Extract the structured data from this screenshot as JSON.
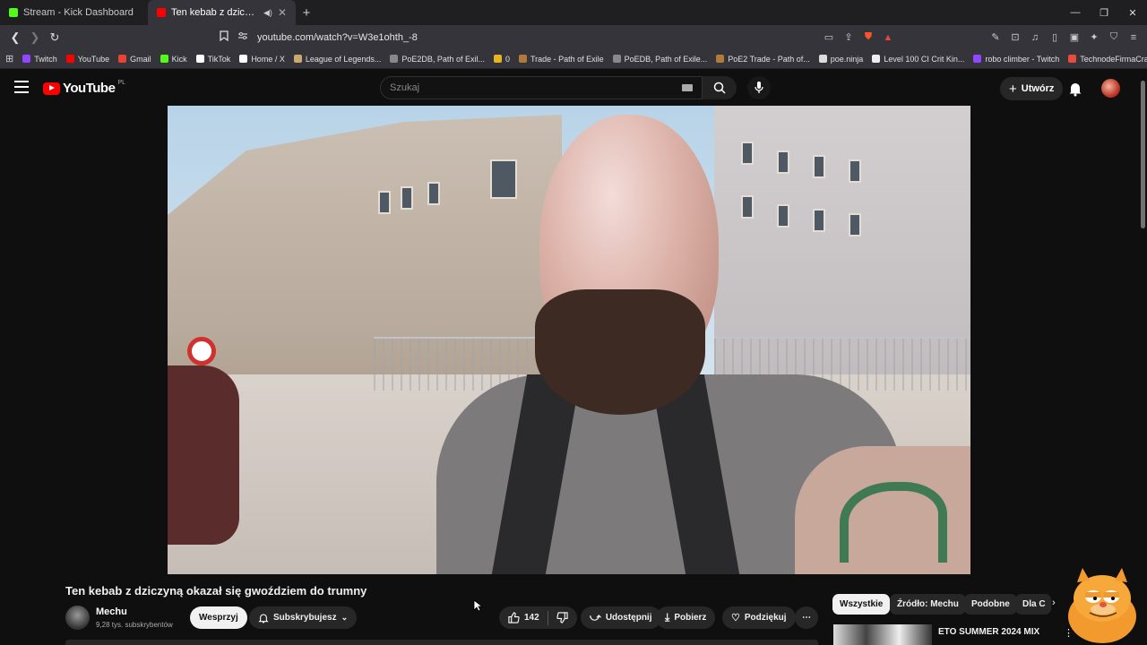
{
  "browser": {
    "tabs": [
      {
        "label": "Stream - Kick Dashboard",
        "color": "#53fc18",
        "active": false
      },
      {
        "label": "Ten kebab z dziczyną okazał",
        "color": "#ff0000",
        "active": true
      }
    ],
    "url": "youtube.com/watch?v=W3e1ohth_-8",
    "bookmarks": [
      {
        "label": "Twitch",
        "color": "#9146ff"
      },
      {
        "label": "YouTube",
        "color": "#ff0000"
      },
      {
        "label": "Gmail",
        "color": "#ea4335"
      },
      {
        "label": "Kick",
        "color": "#53fc18"
      },
      {
        "label": "TikTok",
        "color": "#ffffff"
      },
      {
        "label": "Home / X",
        "color": "#ffffff"
      },
      {
        "label": "League of Legends...",
        "color": "#c8aa6e"
      },
      {
        "label": "PoE2DB, Path of Exil...",
        "color": "#888888"
      },
      {
        "label": "0",
        "color": "#e6b422"
      },
      {
        "label": "Trade - Path of Exile",
        "color": "#b07a3a"
      },
      {
        "label": "PoEDB, Path of Exile...",
        "color": "#888888"
      },
      {
        "label": "PoE2 Trade - Path of...",
        "color": "#b07a3a"
      },
      {
        "label": "poe.ninja",
        "color": "#dddddd"
      },
      {
        "label": "Level 100 CI Crit Kin...",
        "color": "#eeeeee"
      },
      {
        "label": "robo climber - Twitch",
        "color": "#9146ff"
      },
      {
        "label": "TechnodeFirmaCraft...",
        "color": "#e74c3c"
      }
    ]
  },
  "youtube": {
    "logo_text": "YouTube",
    "country_code": "PL",
    "search_placeholder": "Szukaj",
    "create_label": "Utwórz"
  },
  "video": {
    "title": "Ten kebab z dziczyną okazał się gwoździem do trumny",
    "channel_name": "Mechu",
    "subscribers": "9,28 tys. subskrybentów",
    "support_label": "Wesprzyj",
    "subscribed_label": "Subskrybujesz",
    "likes": "142",
    "share_label": "Udostępnij",
    "download_label": "Pobierz",
    "thanks_label": "Podziękuj"
  },
  "sidebar": {
    "chips": [
      "Wszystkie",
      "Źródło: Mechu",
      "Podobne",
      "Dla C"
    ],
    "recommendations": [
      {
        "title": "ETO SUMMER 2024 MIX"
      }
    ]
  }
}
